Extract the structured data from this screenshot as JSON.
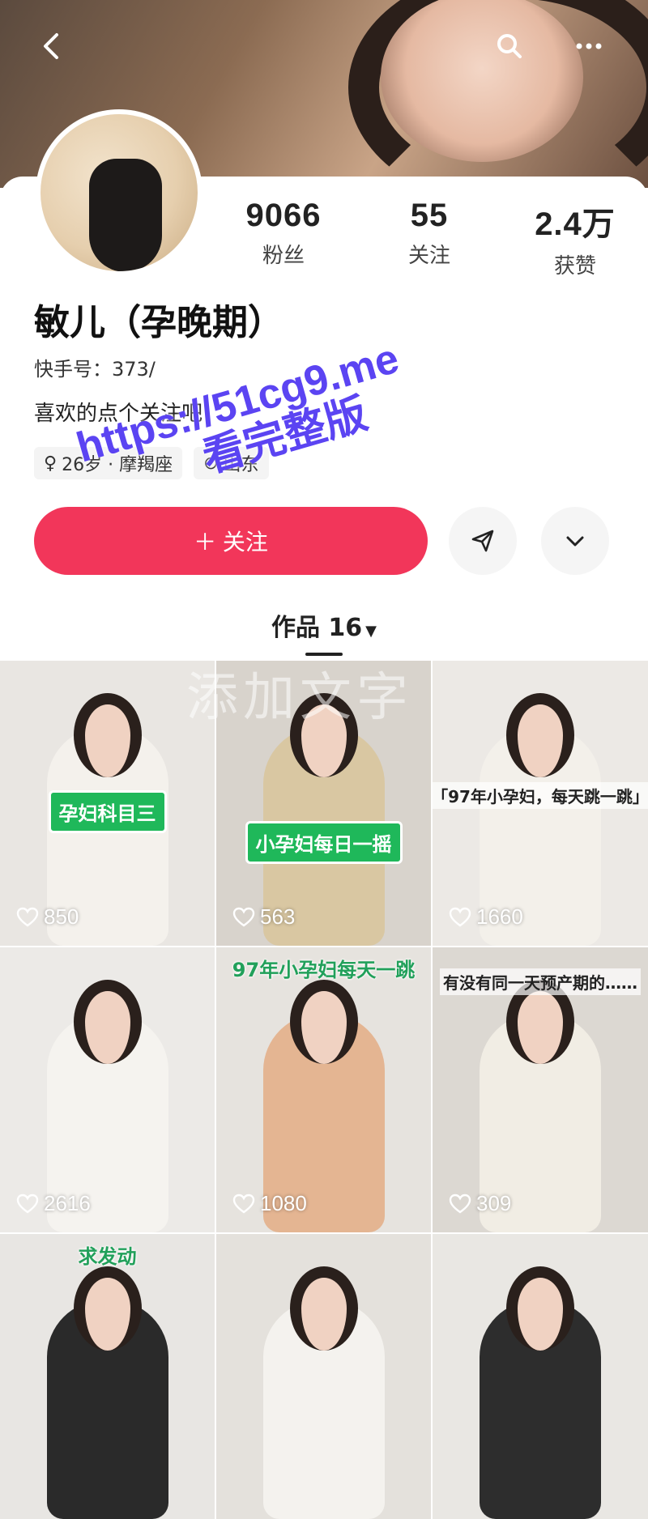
{
  "profile": {
    "name": "敏儿（孕晚期）",
    "kuaishou_id": "快手号：373/",
    "bio": "喜欢的点个关注吧",
    "age_zodiac": "26岁 · 摩羯座",
    "location": "山东",
    "stats": [
      {
        "value": "9066",
        "label": "粉丝"
      },
      {
        "value": "55",
        "label": "关注"
      },
      {
        "value": "2.4万",
        "label": "获赞"
      }
    ]
  },
  "actions": {
    "follow_label": "＋ 关注"
  },
  "works": {
    "tab_label": "作品 16"
  },
  "background_watermark": "添加文字",
  "watermark": {
    "line1": "https://51cg9.me",
    "line2": "看完整版"
  },
  "grid": [
    {
      "likes": "850",
      "caption": "孕妇科目三",
      "style": "green",
      "bg": "#e9e6e2",
      "outfit": "#f4f1ec"
    },
    {
      "likes": "563",
      "caption": "小孕妇每日一摇",
      "style": "green",
      "bg": "#d8d3cc",
      "outfit": "#d9c7a2"
    },
    {
      "likes": "1660",
      "caption": "「97年小孕妇，每天跳一跳」",
      "style": "dark",
      "bg": "#ece9e5",
      "outfit": "#f3f0ea"
    },
    {
      "likes": "2616",
      "caption": "",
      "style": "none",
      "bg": "#eceae7",
      "outfit": "#f5f3ef"
    },
    {
      "likes": "1080",
      "caption": "97年小孕妇每天一跳",
      "style": "text",
      "bg": "#e6e3de",
      "outfit": "#e4b592"
    },
    {
      "likes": "309",
      "caption": "有没有同一天预产期的……",
      "style": "dark",
      "bg": "#dcd8d2",
      "outfit": "#f1ede4"
    },
    {
      "likes": "",
      "caption": "求发动",
      "style": "text",
      "bg": "#e8e6e3",
      "outfit": "#2a2a2a"
    },
    {
      "likes": "",
      "caption": "",
      "style": "none",
      "bg": "#e4e1dc",
      "outfit": "#f4f2ee"
    },
    {
      "likes": "",
      "caption": "",
      "style": "none",
      "bg": "#e9e7e3",
      "outfit": "#2d2d2d"
    }
  ]
}
